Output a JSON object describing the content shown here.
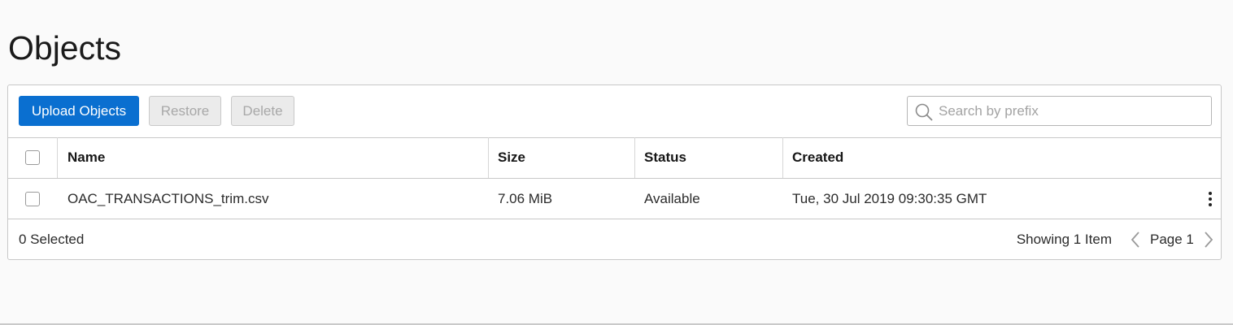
{
  "page": {
    "title": "Objects"
  },
  "toolbar": {
    "upload_label": "Upload Objects",
    "restore_label": "Restore",
    "delete_label": "Delete",
    "search": {
      "placeholder": "Search by prefix",
      "value": "",
      "icon": "search-icon"
    }
  },
  "table": {
    "columns": [
      "Name",
      "Size",
      "Status",
      "Created"
    ],
    "rows": [
      {
        "name": "OAC_TRANSACTIONS_trim.csv",
        "size": "7.06 MiB",
        "status": "Available",
        "created": "Tue, 30 Jul 2019 09:30:35 GMT",
        "actions_icon": "kebab-menu-icon"
      }
    ]
  },
  "footer": {
    "selected": "0 Selected",
    "showing": "Showing 1 Item",
    "page": "Page 1",
    "prev_icon": "chevron-left-icon",
    "next_icon": "chevron-right-icon"
  },
  "colors": {
    "primary": "#0a6fd0",
    "background": "#fafafa",
    "border": "#c8c8c8"
  }
}
